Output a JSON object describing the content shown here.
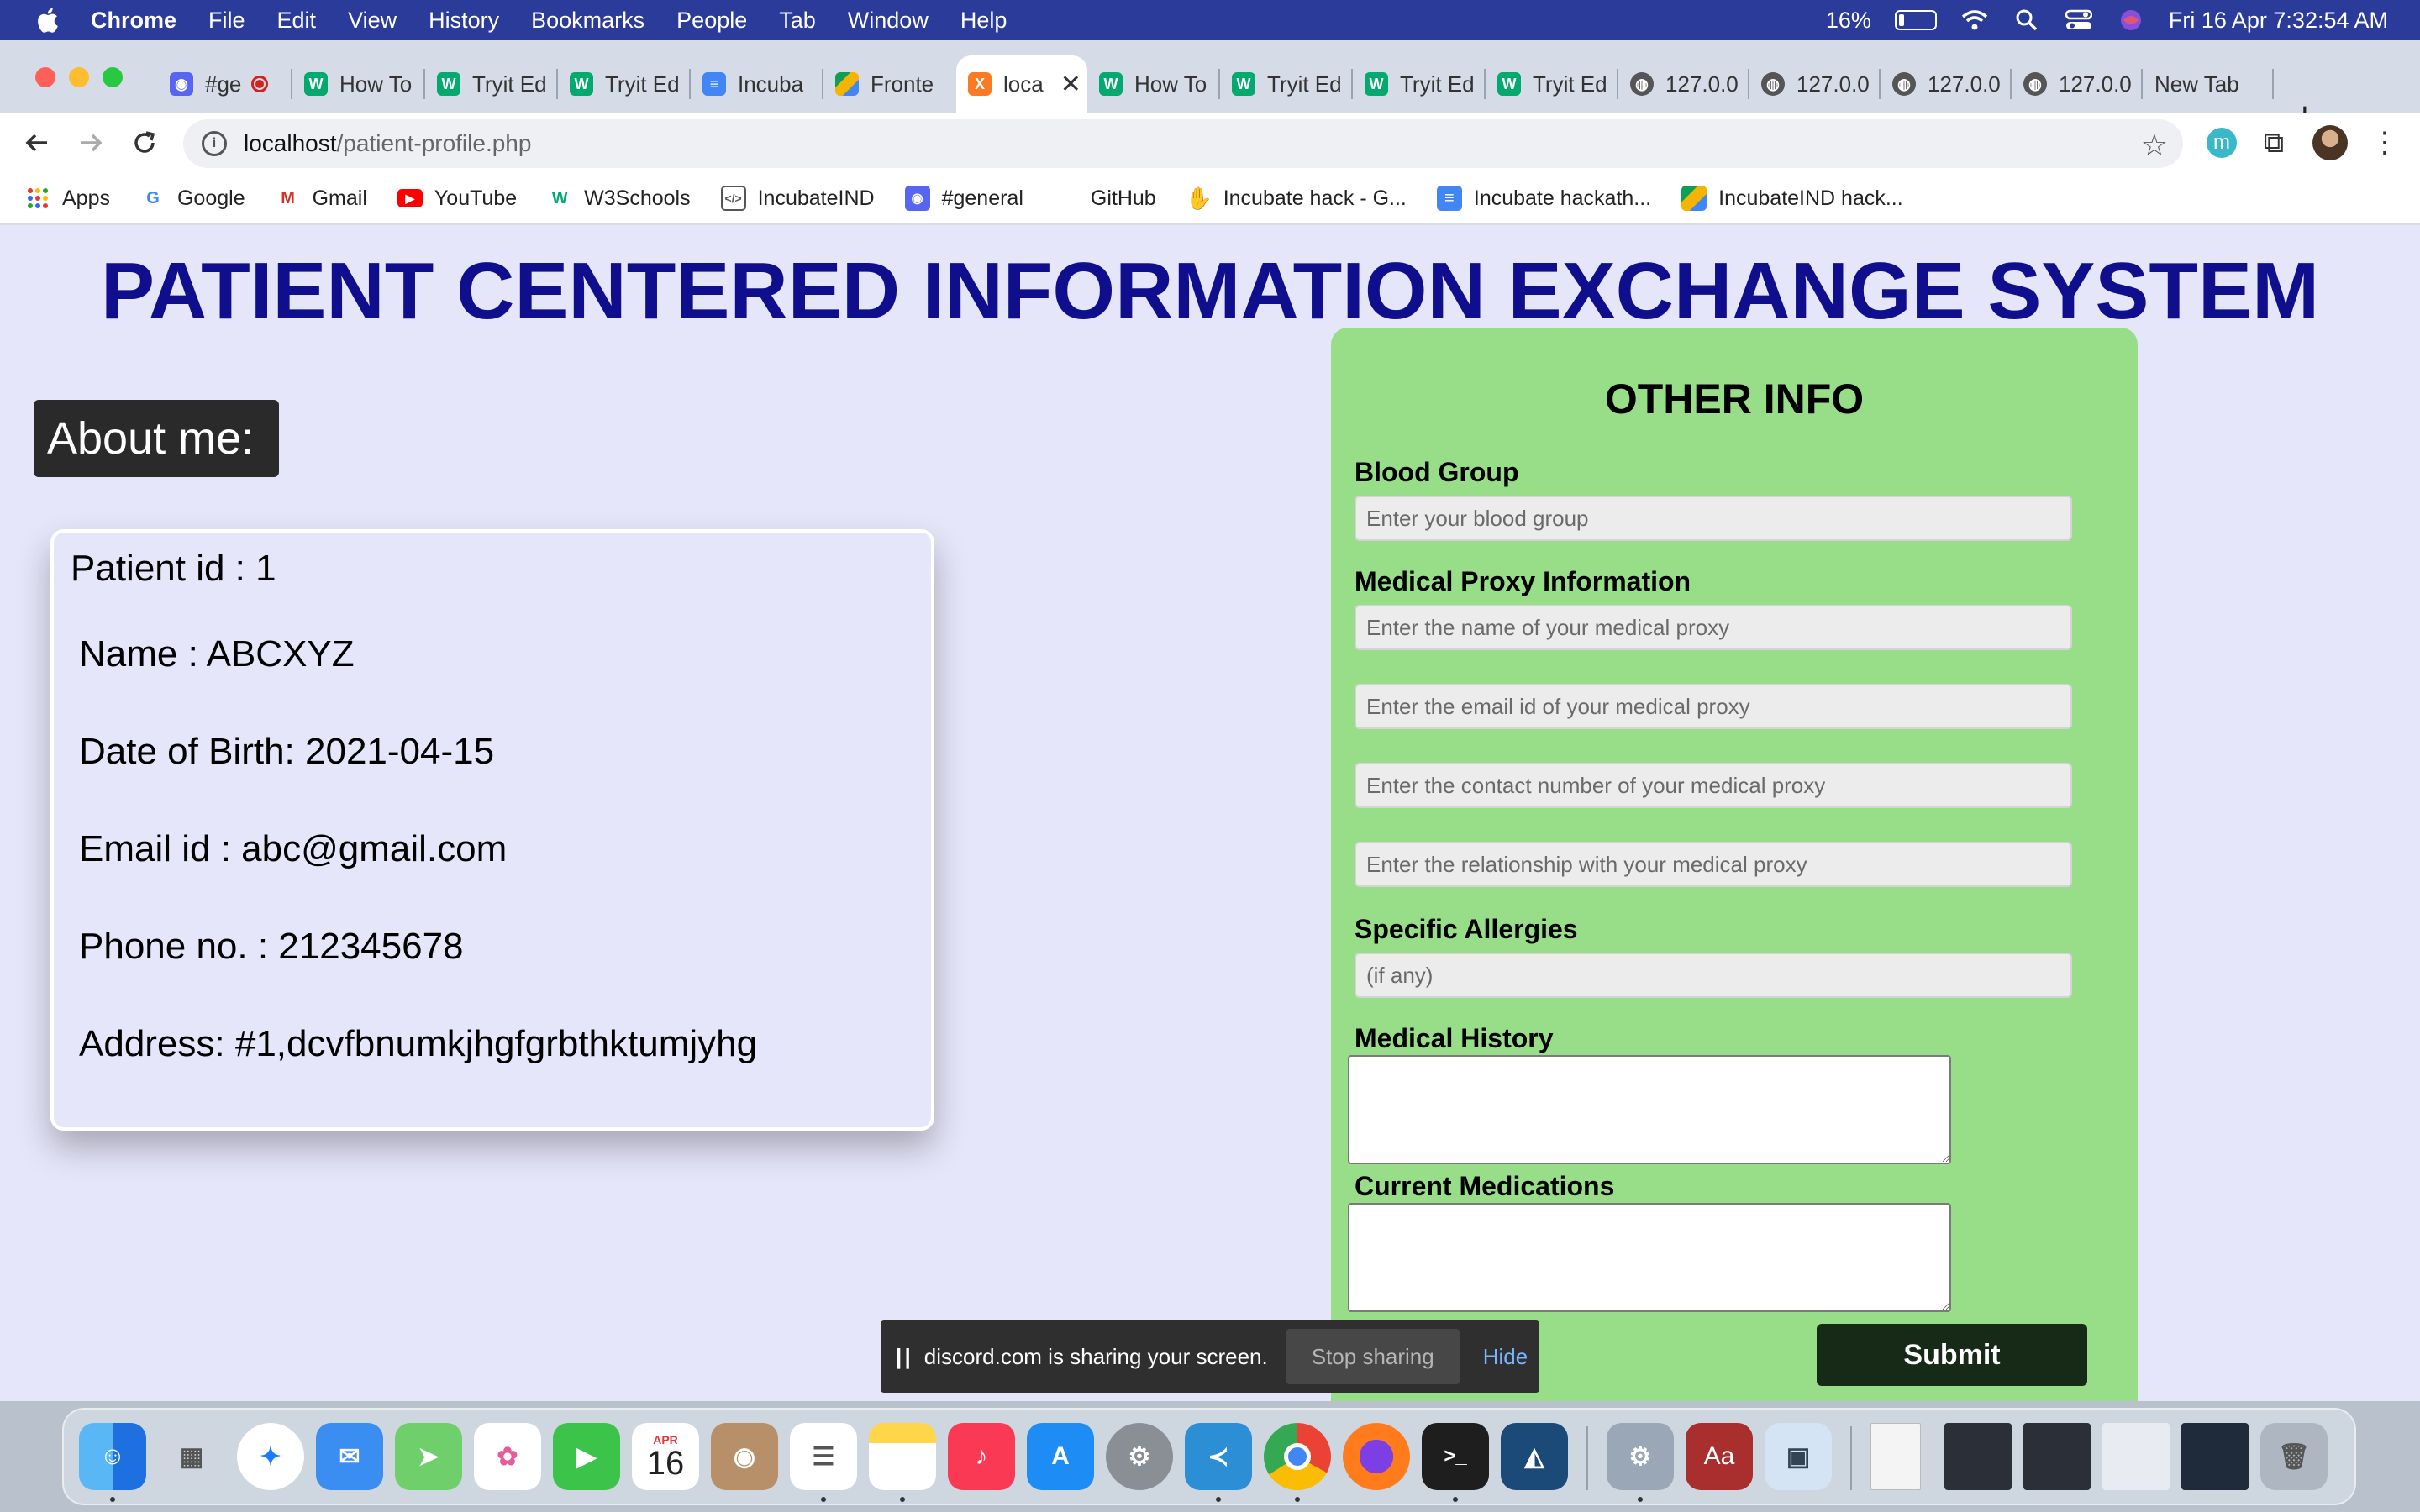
{
  "menubar": {
    "app_name": "Chrome",
    "items": [
      "File",
      "Edit",
      "View",
      "History",
      "Bookmarks",
      "People",
      "Tab",
      "Window",
      "Help"
    ],
    "battery_percent": "16%",
    "battery_level": 0.16,
    "datetime": "Fri 16 Apr  7:32:54 AM",
    "icons": [
      "apple-icon",
      "battery-icon",
      "wifi-icon",
      "spotlight-search-icon",
      "control-center-icon",
      "siri-icon"
    ]
  },
  "tabs": [
    {
      "label": "#ge",
      "icon": "discord-icon",
      "recording": true
    },
    {
      "label": "How To",
      "icon": "w3schools-icon"
    },
    {
      "label": "Tryit Ed",
      "icon": "w3schools-icon"
    },
    {
      "label": "Tryit Ed",
      "icon": "w3schools-icon"
    },
    {
      "label": "Incuba",
      "icon": "google-docs-icon"
    },
    {
      "label": "Fronte",
      "icon": "google-drive-icon"
    },
    {
      "label": "loca",
      "icon": "xampp-icon",
      "active": true
    },
    {
      "label": "How To",
      "icon": "w3schools-icon"
    },
    {
      "label": "Tryit Ed",
      "icon": "w3schools-icon"
    },
    {
      "label": "Tryit Ed",
      "icon": "w3schools-icon"
    },
    {
      "label": "Tryit Ed",
      "icon": "w3schools-icon"
    },
    {
      "label": "127.0.0",
      "icon": "globe-icon"
    },
    {
      "label": "127.0.0",
      "icon": "globe-icon"
    },
    {
      "label": "127.0.0",
      "icon": "globe-icon"
    },
    {
      "label": "127.0.0",
      "icon": "globe-icon"
    },
    {
      "label": "New Tab",
      "icon": ""
    }
  ],
  "toolbar": {
    "url_host": "localhost",
    "url_path": "/patient-profile.php",
    "extension_letter": "m"
  },
  "bookmarks": [
    {
      "label": "Apps",
      "icon": "apps-grid-icon"
    },
    {
      "label": "Google",
      "icon": "google-icon"
    },
    {
      "label": "Gmail",
      "icon": "gmail-icon"
    },
    {
      "label": "YouTube",
      "icon": "youtube-icon"
    },
    {
      "label": "W3Schools",
      "icon": "w3schools-icon"
    },
    {
      "label": "IncubateIND",
      "icon": "code-icon"
    },
    {
      "label": "#general",
      "icon": "discord-icon"
    },
    {
      "label": "GitHub",
      "icon": ""
    },
    {
      "label": "Incubate hack - G...",
      "icon": "hand-icon"
    },
    {
      "label": "Incubate hackath...",
      "icon": "google-docs-icon"
    },
    {
      "label": "IncubateIND hack...",
      "icon": "google-drive-icon"
    }
  ],
  "page": {
    "title": "PATIENT CENTERED INFORMATION EXCHANGE SYSTEM",
    "about_heading": "About me:",
    "patient": {
      "id_line": "Patient id : 1",
      "name_line": "Name : ABCXYZ",
      "dob_line": "Date of Birth: 2021-04-15",
      "email_line": "Email id : abc@gmail.com",
      "phone_line": "Phone no. : 212345678",
      "address_line": "Address: #1,dcvfbnumkjhgfgrbthktumjyhg"
    },
    "other_info": {
      "title": "OTHER INFO",
      "blood_group_label": "Blood Group",
      "blood_group_placeholder": "Enter your blood group",
      "proxy_label": "Medical Proxy Information",
      "proxy_name_placeholder": "Enter the name of your medical proxy",
      "proxy_email_placeholder": "Enter the email id of your medical proxy",
      "proxy_contact_placeholder": "Enter the contact number of your medical proxy",
      "proxy_relationship_placeholder": "Enter the relationship with your medical proxy",
      "allergies_label": "Specific Allergies",
      "allergies_placeholder": "(if any)",
      "history_label": "Medical History",
      "medications_label": "Current Medications",
      "submit_label": "Submit"
    }
  },
  "share_banner": {
    "message": "discord.com is sharing your screen.",
    "stop_label": "Stop sharing",
    "hide_label": "Hide"
  },
  "dock": {
    "calendar_month": "APR",
    "calendar_day": "16",
    "apps": [
      "finder-icon",
      "launchpad-icon",
      "safari-icon",
      "mail-icon",
      "maps-icon",
      "photos-icon",
      "facetime-icon",
      "calendar-icon",
      "contacts-icon",
      "reminders-icon",
      "notes-icon",
      "music-icon",
      "app-store-icon",
      "system-preferences-icon",
      "vscode-icon",
      "chrome-icon",
      "firefox-icon",
      "terminal-icon",
      "mysql-workbench-icon",
      "settings-gear-icon",
      "dictionary-icon",
      "preview-icon",
      "document-thumbnail-icon",
      "window-thumbnail-icon",
      "trash-icon"
    ]
  },
  "colors": {
    "menubar_bg": "#2b3b9a",
    "page_bg": "#e6e6fa",
    "title_color": "#0f0f8e",
    "panel_green": "#98de89",
    "submit_bg": "#172a17"
  }
}
